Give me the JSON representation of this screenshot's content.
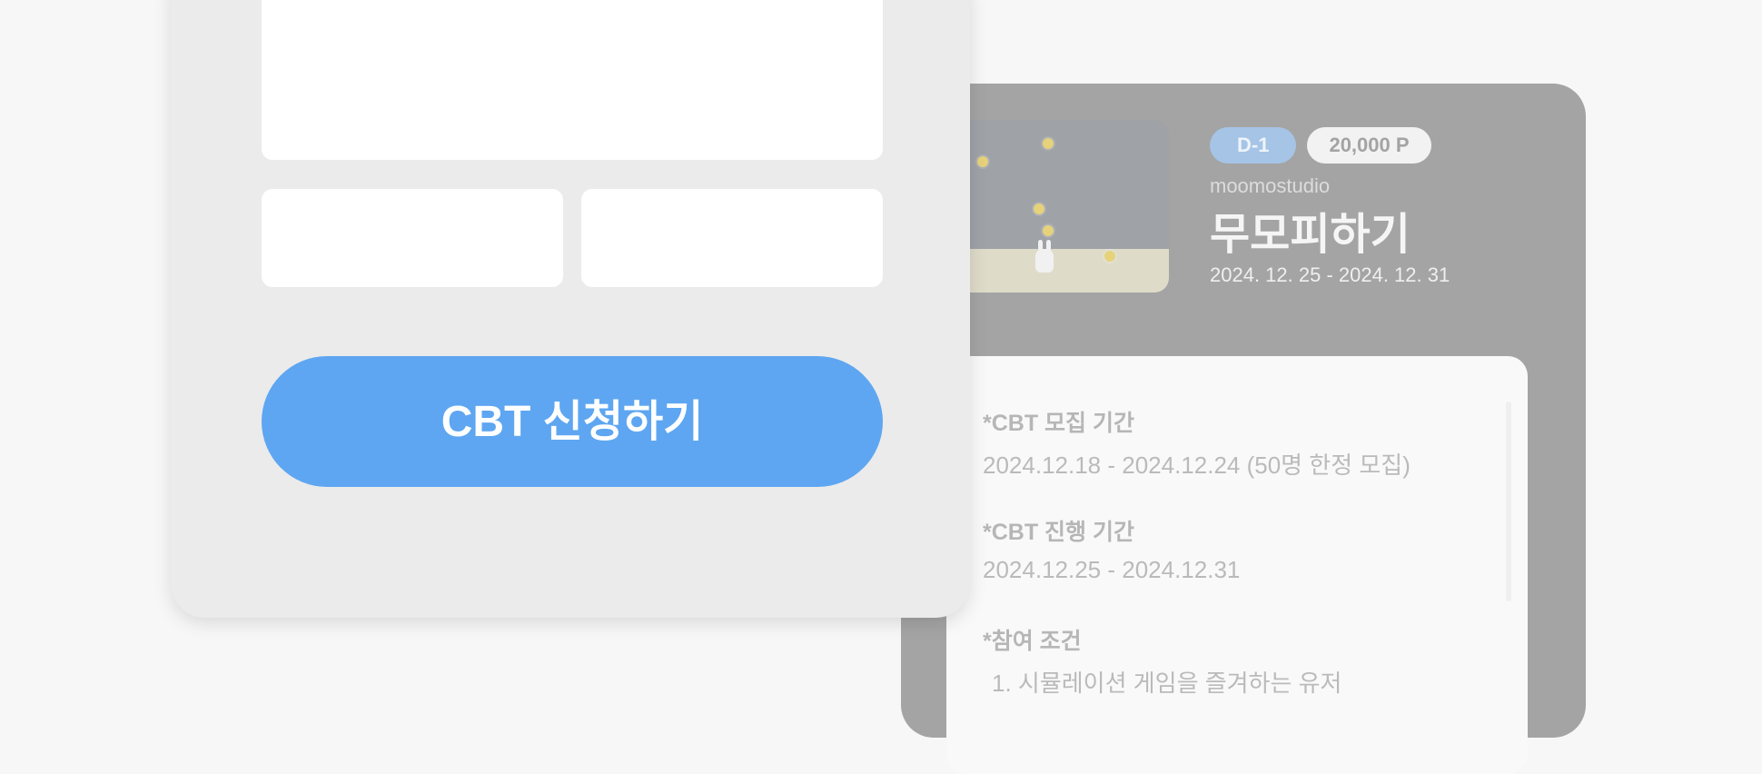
{
  "detail": {
    "dday_badge": "D-1",
    "points_badge": "20,000 P",
    "studio": "moomostudio",
    "title": "무모피하기",
    "period": "2024. 12. 25 - 2024. 12. 31",
    "sections": [
      {
        "label": "*CBT 모집 기간",
        "value": "2024.12.18 - 2024.12.24 (50명 한정 모집)"
      },
      {
        "label": "*CBT 진행 기간",
        "value": "2024.12.25 - 2024.12.31"
      },
      {
        "label": "*참여 조건",
        "value": "1. 시뮬레이션 게임을 즐겨하는 유저"
      }
    ]
  },
  "form": {
    "apply_label": "CBT 신청하기"
  },
  "colors": {
    "page_bg": "#f7f7f7",
    "accent": "#5ea6f1",
    "dday_badge": "#a5c4e6"
  },
  "icons": [
    "game-thumbnail-image"
  ]
}
